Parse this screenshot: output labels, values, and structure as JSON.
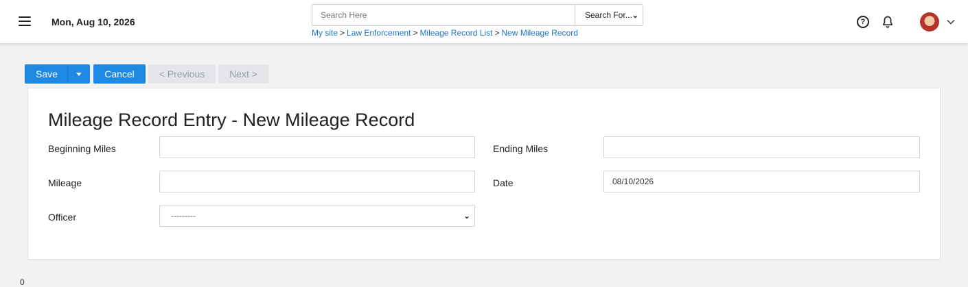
{
  "header": {
    "date": "Mon, Aug 10, 2026",
    "search": {
      "placeholder": "Search Here",
      "select_value": "Search For..."
    },
    "breadcrumb": [
      "My site",
      "Law Enforcement",
      "Mileage Record List",
      "New Mileage Record"
    ],
    "breadcrumb_separator": ">"
  },
  "toolbar": {
    "save_label": "Save",
    "cancel_label": "Cancel",
    "previous_label": "< Previous",
    "next_label": "Next >"
  },
  "form": {
    "title": "Mileage Record Entry - New Mileage Record",
    "beginning_miles": {
      "label": "Beginning Miles",
      "value": ""
    },
    "ending_miles": {
      "label": "Ending Miles",
      "value": ""
    },
    "mileage": {
      "label": "Mileage",
      "value": ""
    },
    "date": {
      "label": "Date",
      "value": "08/10/2026"
    },
    "officer": {
      "label": "Officer",
      "selected": "---------"
    }
  },
  "footer": {
    "stray_text": "0"
  },
  "colors": {
    "primary": "#1e88e5",
    "link": "#1a73c8",
    "disabled_bg": "#e3e5e8",
    "page_bg": "#f2f2f2"
  },
  "icons": [
    "menu-icon",
    "help-icon",
    "bell-icon",
    "avatar",
    "chevron-down-icon"
  ]
}
